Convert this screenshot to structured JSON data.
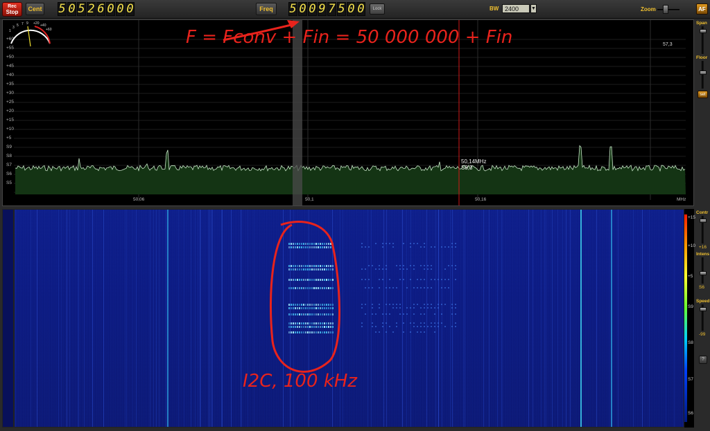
{
  "toolbar": {
    "stop_label_small": "Rec",
    "stop_label": "Stop",
    "cent_label": "Cent",
    "cent_digits": [
      "5",
      "0",
      "5",
      "2",
      "6",
      "0",
      "0",
      "0"
    ],
    "freq_label": "Freq",
    "freq_digits": [
      "5",
      "0",
      "0",
      "9",
      "7",
      "5",
      "0",
      "0"
    ],
    "lock_label": "Lock",
    "bw_label": "BW",
    "bw_value": "2400",
    "bw_arrow": "▼",
    "zoom_label": "Zoom",
    "af_label": "AF"
  },
  "spectrum": {
    "db_labels": [
      "+60",
      "+55",
      "+50",
      "+45",
      "+40",
      "+35",
      "+30",
      "+25",
      "+20",
      "+15",
      "+10",
      "+5",
      "S9",
      "S8",
      "S7",
      "S6",
      "S5"
    ],
    "freq_ticks": [
      "50,06",
      "50,1",
      "50,16",
      "MHz"
    ],
    "marker_freq": "50,14MHz",
    "marker_s": "S8,3",
    "smeter_scale": [
      "1",
      "3",
      "5",
      "7",
      "9",
      "+20",
      "+40",
      "+60"
    ],
    "smeter_value": "57,3"
  },
  "side": {
    "span_label": "Span",
    "floor_label": "Floor",
    "set_label": "set",
    "contr_label": "Contr",
    "contr_value": "+16",
    "intens_label": "Intens",
    "intens_value": "S6",
    "speed_label": "Speed",
    "speed_value": "-99",
    "small_btn": "?"
  },
  "waterfall": {
    "scale_labels": [
      "+15",
      "+10",
      "+5",
      "S9",
      "S8",
      "S7",
      "S6"
    ]
  },
  "annotations": {
    "formula": "F = Fconv + Fin = 50 000 000 + Fin",
    "i2c": "I2C, 100 kHz"
  },
  "colors": {
    "accent_yellow": "#f0c030",
    "digit_yellow": "#f6e24a",
    "annotation_red": "#e8231c",
    "marker_red": "#d01818",
    "waterfall_blue": "#0c1c8a",
    "spectrum_fill": "#143414"
  }
}
